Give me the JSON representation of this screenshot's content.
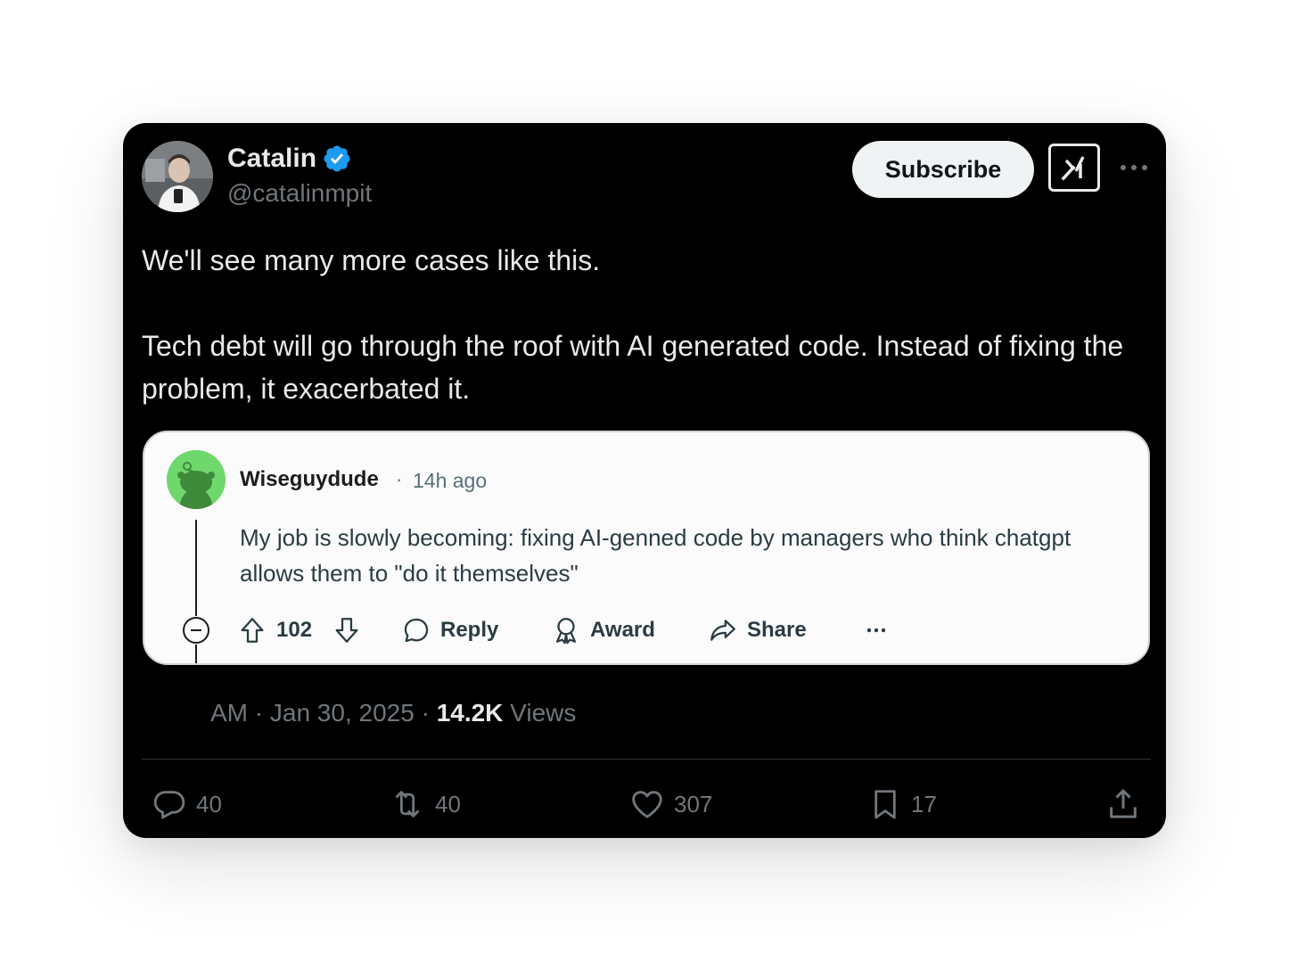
{
  "tweet": {
    "author_name": "Catalin",
    "author_handle": "@catalinmpit",
    "subscribe_label": "Subscribe",
    "text_line_1": "We'll see many more cases like this.",
    "text_line_2": "Tech debt will go through the roof with AI generated code. Instead of fixing the problem, it exacerbated it.",
    "meta_time": "AM · Jan 30, 2025 · ",
    "views_count": "14.2K",
    "views_label": " Views",
    "stats": {
      "replies": "40",
      "reposts": "40",
      "likes": "307",
      "bookmarks": "17"
    }
  },
  "reddit_comment": {
    "username": "Wiseguydude",
    "separator": "·",
    "time_ago": "14h ago",
    "body": "My job is slowly becoming: fixing AI-genned code by managers who think chatgpt allows them to \"do it themselves\"",
    "vote_count": "102",
    "reply_label": "Reply",
    "award_label": "Award",
    "share_label": "Share"
  },
  "colors": {
    "card_bg": "#000000",
    "verified_blue": "#1d9bf0",
    "reddit_avatar_green": "#6fd86d"
  },
  "icons": [
    "verified-badge-icon",
    "grok-icon",
    "more-icon",
    "upvote-icon",
    "downvote-icon",
    "comment-icon",
    "award-icon",
    "share-icon",
    "collapse-icon",
    "reply-icon",
    "repost-icon",
    "like-icon",
    "bookmark-icon",
    "upload-share-icon"
  ]
}
